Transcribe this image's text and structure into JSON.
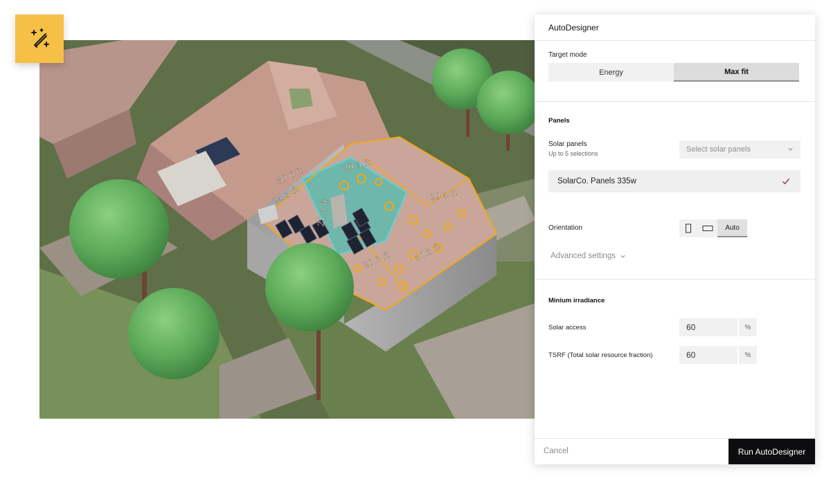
{
  "panel": {
    "title": "AutoDesigner",
    "target_mode": {
      "label": "Target mode",
      "options": [
        "Energy",
        "Max fit"
      ],
      "selected": "Max fit"
    },
    "panels_section": {
      "title": "Panels",
      "solar_panels_label": "Solar panels",
      "solar_panels_hint": "Up to 5 selections",
      "select_placeholder": "Select solar panels",
      "selected_item": "SolarCo. Panels 335w",
      "orientation_label": "Orientation",
      "orientation_options": [
        "portrait-icon",
        "landscape-icon",
        "Auto"
      ],
      "orientation_selected": "Auto",
      "advanced_settings": "Advanced settings"
    },
    "irradiance": {
      "title": "Minium irradiance",
      "solar_access_label": "Solar access",
      "solar_access_value": "60",
      "tsrf_label": "TSRF (Total solar resource fraction)",
      "tsrf_value": "60",
      "unit": "%"
    },
    "footer": {
      "cancel": "Cancel",
      "run": "Run AutoDesigner"
    }
  },
  "magic_button": {
    "icon": "magic-wand-icon",
    "color": "#f6bf45"
  },
  "measurements": [
    "50.6 ft",
    "20.5 ft",
    "24.3 ft",
    "21.3 ft",
    "29.4 ft",
    "20.3 ft",
    "50.5 ft"
  ],
  "colors": {
    "roof_outline": "#f2a818",
    "selection": "#5ed3d3",
    "tree": "#5ca85a",
    "run_button": "#0d0d0f"
  }
}
